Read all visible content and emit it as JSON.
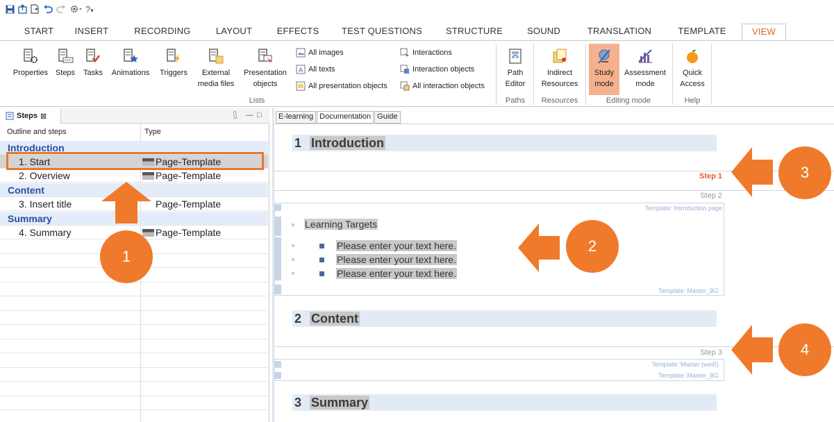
{
  "colors": {
    "accent": "#f07a2b",
    "selection_outline": "#e8772e",
    "section_text": "#2a4ea0",
    "section_bg": "#e3ecf8",
    "active_tab_text": "#d9602a",
    "active_step": "#e0602a"
  },
  "quick_access": [
    "save-icon",
    "publish-icon",
    "new-document-icon",
    "undo-icon",
    "redo-icon",
    "settings-icon",
    "help-icon"
  ],
  "quick_access_help": "?",
  "ribbon_tabs": [
    "START",
    "INSERT",
    "RECORDING",
    "LAYOUT",
    "EFFECTS",
    "TEST QUESTIONS",
    "STRUCTURE",
    "SOUND",
    "TRANSLATION",
    "TEMPLATE",
    "VIEW"
  ],
  "active_tab": "VIEW",
  "ribbon": {
    "lists": {
      "buttons": [
        "Properties",
        "Steps",
        "Tasks",
        "Animations",
        "Triggers"
      ],
      "external_media_l1": "External",
      "external_media_l2": "media files",
      "presentation_l1": "Presentation",
      "presentation_l2": "objects",
      "small": [
        "All images",
        "All texts",
        "All presentation objects",
        "Interactions",
        "Interaction objects",
        "All interaction objects"
      ],
      "label": "Lists"
    },
    "paths": {
      "btn_l1": "Path",
      "btn_l2": "Editor",
      "label": "Paths"
    },
    "resources": {
      "btn_l1": "Indirect",
      "btn_l2": "Resources",
      "label": "Resources"
    },
    "editing_mode": {
      "study_l1": "Study",
      "study_l2": "mode",
      "assess_l1": "Assessment",
      "assess_l2": "mode",
      "label": "Editing mode"
    },
    "help": {
      "btn_l1": "Quick",
      "btn_l2": "Access",
      "label": "Help"
    }
  },
  "steps_panel": {
    "tab_label": "Steps",
    "close_glyph": "⊠",
    "controls": [
      "⩉",
      "—",
      "□"
    ],
    "col_outline": "Outline and steps",
    "col_type": "Type",
    "rows": [
      {
        "kind": "section",
        "label": "Introduction"
      },
      {
        "kind": "step",
        "label": "1. Start",
        "type": "Page-Template",
        "selected": true
      },
      {
        "kind": "step",
        "label": "2. Overview",
        "type": "Page-Template"
      },
      {
        "kind": "section",
        "label": "Content"
      },
      {
        "kind": "step",
        "label": "3. Insert title",
        "type": "Page-Template"
      },
      {
        "kind": "section",
        "label": "Summary"
      },
      {
        "kind": "step",
        "label": "4. Summary",
        "type": "Page-Template"
      }
    ]
  },
  "doc_tabs": [
    "E-learning",
    "Documentation",
    "Guide"
  ],
  "active_doc_tab": "Documentation",
  "document": {
    "h1_num": "1",
    "h1_title": "Introduction",
    "step1": "Step 1",
    "step2": "Step 2",
    "tpl_intro": "Template: Introduction page",
    "learning_targets": "Learning Targets",
    "bullets": [
      "Please enter your text here.",
      "Please enter your text here.",
      "Please enter your text here."
    ],
    "tpl_master_bg_1": "Template: Master_BG",
    "h2_num": "2",
    "h2_title": "Content",
    "step3": "Step 3",
    "tpl_master_weiss": "Template: Master (weiß)",
    "tpl_master_bg_2": "Template: Master_BG",
    "h3_num": "3",
    "h3_title": "Summary"
  },
  "callouts": [
    "1",
    "2",
    "3",
    "4"
  ]
}
